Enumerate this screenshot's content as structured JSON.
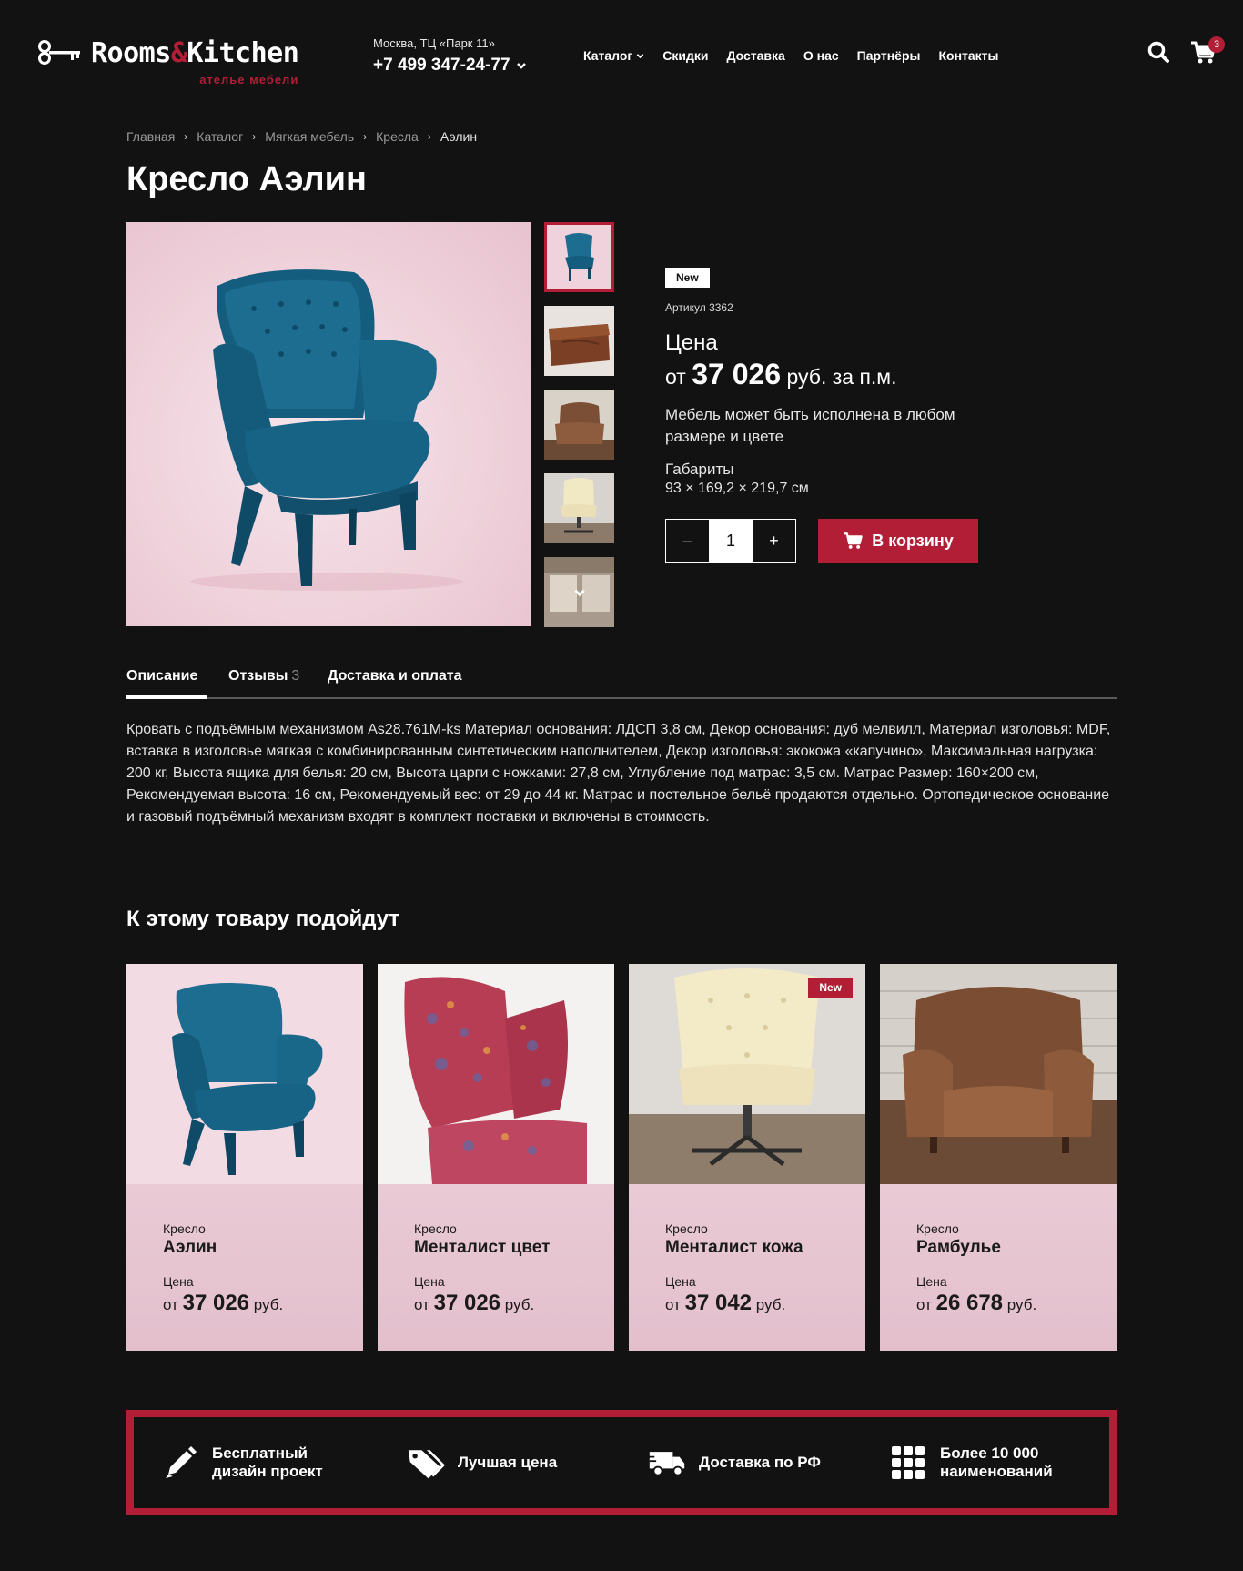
{
  "header": {
    "logo_left": "Rooms",
    "logo_amp": "&",
    "logo_right": "Kitchen",
    "logo_sub": "ателье мебели",
    "address": "Москва, ТЦ «Парк 11»",
    "phone": "+7 499 347-24-77",
    "nav": [
      {
        "label": "Каталог"
      },
      {
        "label": "Скидки"
      },
      {
        "label": "Доставка"
      },
      {
        "label": "О нас"
      },
      {
        "label": "Партнёры"
      },
      {
        "label": "Контакты"
      }
    ],
    "cart_count": "3"
  },
  "breadcrumb": [
    "Главная",
    "Каталог",
    "Мягкая мебель",
    "Кресла",
    "Аэлин"
  ],
  "product": {
    "title": "Кресло Аэлин",
    "badge": "New",
    "sku": "Артикул 3362",
    "price_label": "Цена",
    "price_prefix": "от",
    "price_amount": "37 026",
    "price_suffix": "руб. за п.м.",
    "note": "Мебель может быть исполнена в любом размере и цвете",
    "dims_label": "Габариты",
    "dims": "93 × 169,2 × 219,7 см",
    "qty": "1",
    "qty_minus": "–",
    "qty_plus": "+",
    "cart_button": "В корзину"
  },
  "tabs": [
    {
      "label": "Описание"
    },
    {
      "label": "Отзывы",
      "count": "3"
    },
    {
      "label": "Доставка и оплата"
    }
  ],
  "description": "Кровать с подъёмным механизмом As28.761M-ks Материал основания: ЛДСП 3,8 см, Декор основания: дуб мелвилл, Материал изголовья: MDF, вставка в изголовье мягкая с комбинированным синтетическим наполнителем, Декор изголовья: экокожа «капучино», Максимальная нагрузка: 200 кг, Высота ящика для белья: 20 см, Высота царги с ножками: 27,8 см, Углубление под матрас: 3,5 см. Матрас Размер: 160×200 см, Рекомендуемая высота: 16 см, Рекомендуемый вес: от 29 до 44 кг. Матрас и постельное бельё продаются отдельно. Ортопедическое основание и газовый подъёмный механизм входят в комплект поставки и включены в стоимость.",
  "related": {
    "title": "К этому товару подойдут",
    "items": [
      {
        "category": "Кресло",
        "name": "Аэлин",
        "price_label": "Цена",
        "price_prefix": "от",
        "price": "37 026",
        "currency": "руб."
      },
      {
        "category": "Кресло",
        "name": "Менталист цвет",
        "price_label": "Цена",
        "price_prefix": "от",
        "price": "37 026",
        "currency": "руб."
      },
      {
        "category": "Кресло",
        "name": "Менталист кожа",
        "price_label": "Цена",
        "price_prefix": "от",
        "price": "37 042",
        "currency": "руб.",
        "badge": "New"
      },
      {
        "category": "Кресло",
        "name": "Рамбулье",
        "price_label": "Цена",
        "price_prefix": "от",
        "price": "26 678",
        "currency": "руб."
      }
    ]
  },
  "features": [
    {
      "line1": "Бесплатный",
      "line2": "дизайн проект",
      "icon": "pencil-icon"
    },
    {
      "line1": "Лучшая цена",
      "line2": "",
      "icon": "tags-icon"
    },
    {
      "line1": "Доставка по РФ",
      "line2": "",
      "icon": "truck-icon"
    },
    {
      "line1": "Более 10 000",
      "line2": "наименований",
      "icon": "grid-icon"
    }
  ],
  "colors": {
    "background": "#121213",
    "accent": "#b21e35",
    "card_pink": "#efd2db"
  }
}
